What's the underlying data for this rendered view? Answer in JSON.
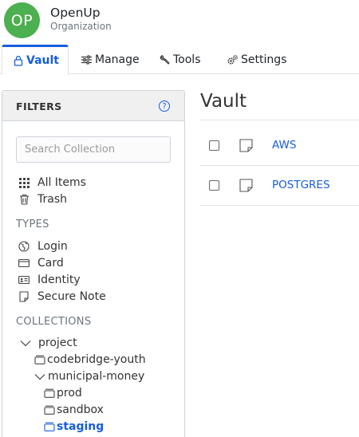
{
  "org": {
    "initials": "OP",
    "name": "OpenUp",
    "subtitle": "Organization",
    "avatar_color": "#4caf50"
  },
  "tabs": [
    {
      "label": "Vault",
      "icon": "lock-icon",
      "active": true
    },
    {
      "label": "Manage",
      "icon": "sliders-icon",
      "active": false
    },
    {
      "label": "Tools",
      "icon": "wrench-icon",
      "active": false
    },
    {
      "label": "Settings",
      "icon": "gears-icon",
      "active": false
    }
  ],
  "filters": {
    "title": "FILTERS",
    "help_icon": "?",
    "search_placeholder": "Search Collection",
    "all_items": "All Items",
    "trash": "Trash",
    "types_label": "TYPES",
    "types": [
      "Login",
      "Card",
      "Identity",
      "Secure Note"
    ],
    "collections_label": "COLLECTIONS",
    "collections": {
      "root": "project",
      "child1": "codebridge-youth",
      "child2": "municipal-money",
      "grandchildren": [
        "prod",
        "sandbox",
        "staging"
      ],
      "active": "staging"
    }
  },
  "vault": {
    "title": "Vault",
    "items": [
      {
        "name": "AWS",
        "icon": "note-icon"
      },
      {
        "name": "POSTGRES",
        "icon": "note-icon"
      }
    ]
  },
  "colors": {
    "accent": "#175ddc",
    "border": "#dee2e6"
  }
}
